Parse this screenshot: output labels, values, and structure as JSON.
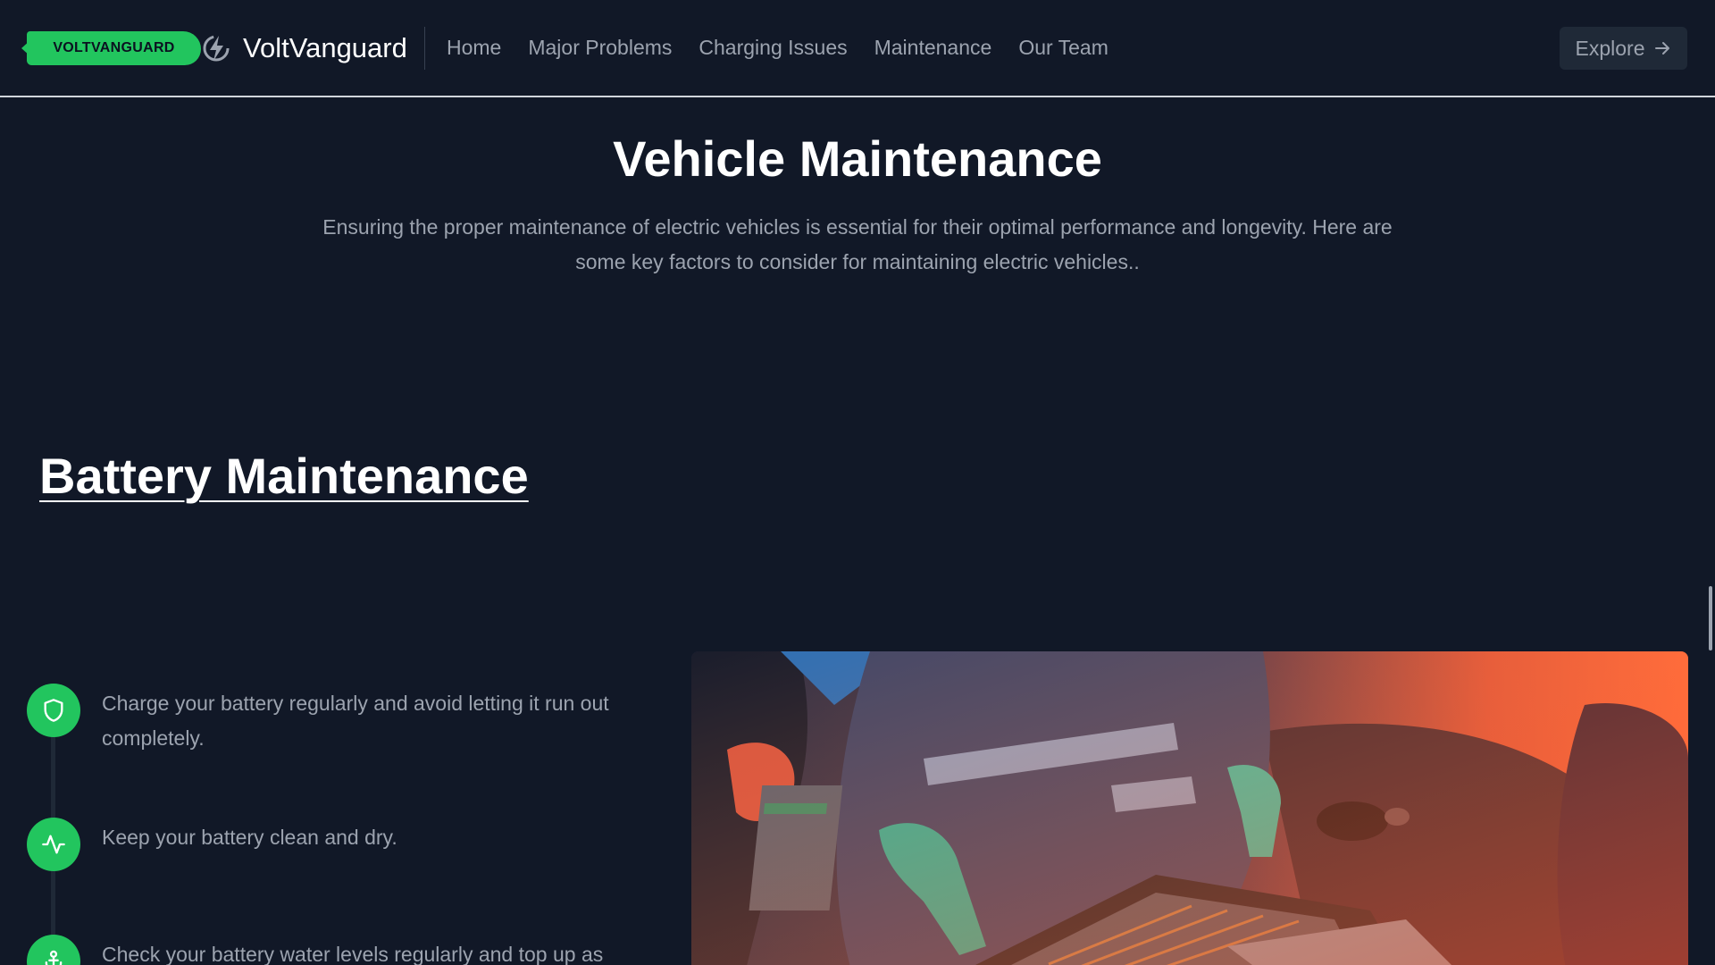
{
  "header": {
    "badge_text": "VOLTVANGUARD",
    "brand_name": "VoltVanguard",
    "brand_icon": "lightning-bolt-icon",
    "nav": [
      {
        "label": "Home"
      },
      {
        "label": "Major Problems"
      },
      {
        "label": "Charging Issues"
      },
      {
        "label": "Maintenance"
      },
      {
        "label": "Our Team"
      }
    ],
    "explore_label": "Explore",
    "explore_icon": "arrow-right-icon"
  },
  "hero": {
    "title": "Vehicle Maintenance",
    "intro": "Ensuring the proper maintenance of electric vehicles is essential for their optimal performance and longevity. Here are some key factors to consider for maintaining electric vehicles.."
  },
  "battery_section": {
    "title": "Battery Maintenance",
    "steps": [
      {
        "icon": "shield-icon",
        "text": "Charge your battery regularly and avoid letting it run out completely."
      },
      {
        "icon": "activity-icon",
        "text": "Keep your battery clean and dry."
      },
      {
        "icon": "anchor-icon",
        "text": "Check your battery water levels regularly and top up as"
      }
    ]
  },
  "colors": {
    "background": "#111827",
    "accent": "#22c55e",
    "muted_text": "#9ca3af"
  }
}
